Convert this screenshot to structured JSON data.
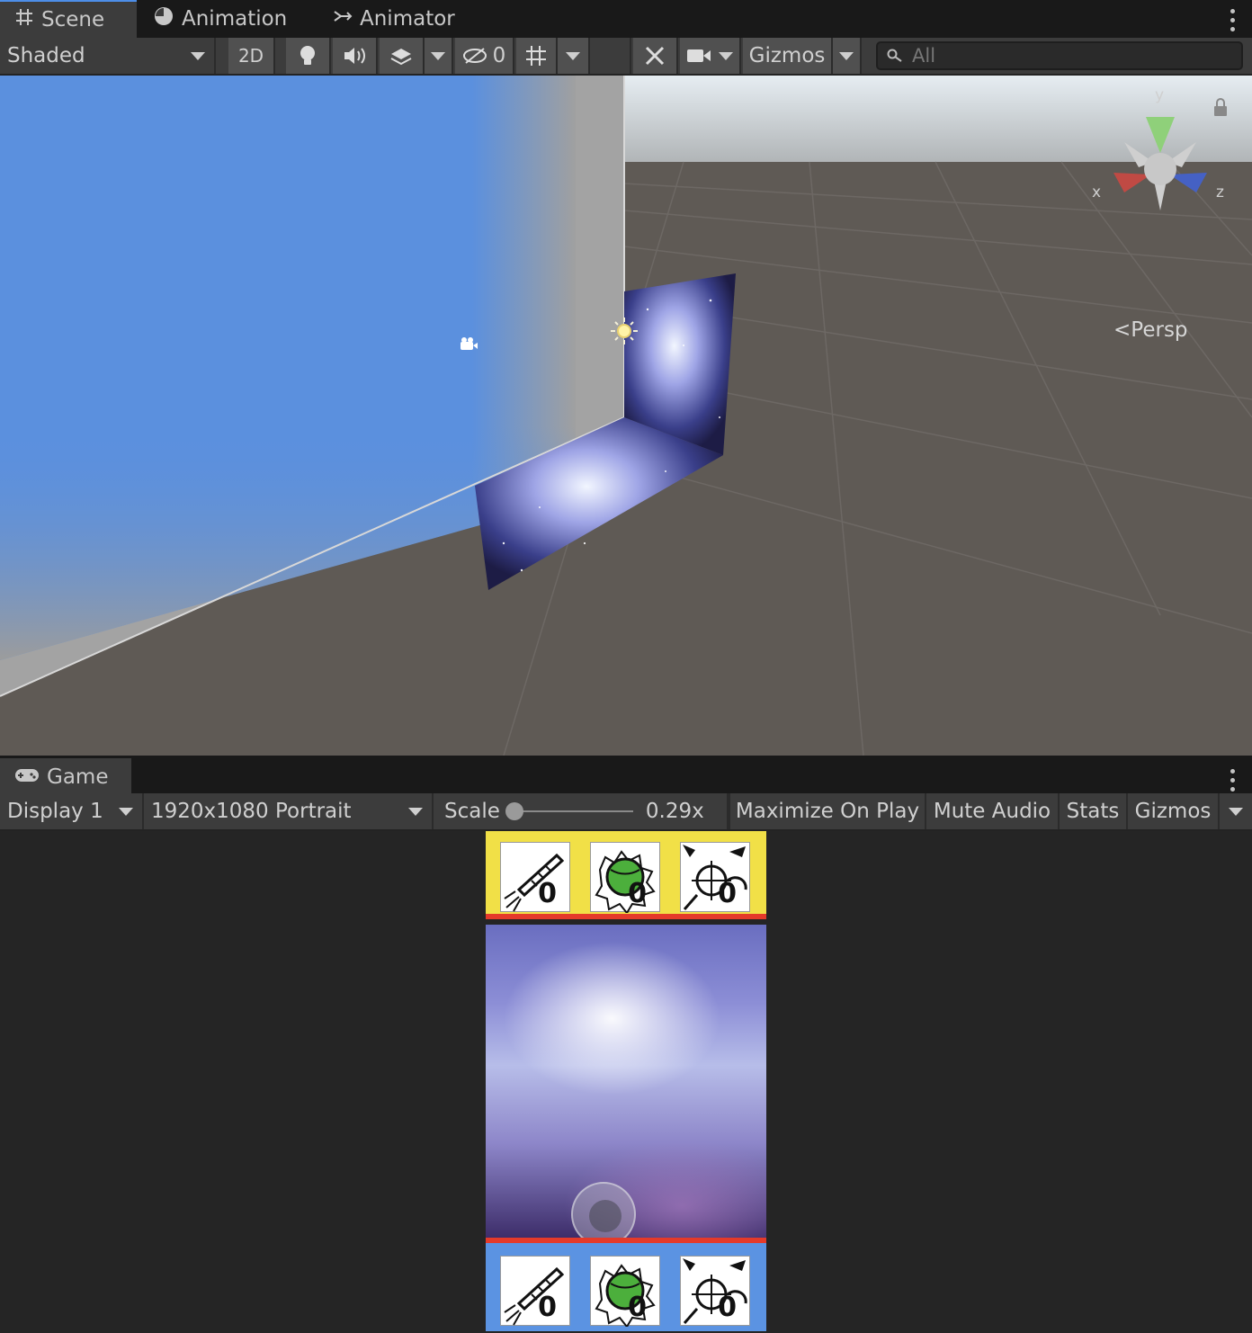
{
  "scene_tabs": [
    {
      "label": "Scene",
      "icon": "grid-hash-icon",
      "active": true
    },
    {
      "label": "Animation",
      "icon": "clock-pie-icon",
      "active": false
    },
    {
      "label": "Animator",
      "icon": "animator-graph-icon",
      "active": false
    }
  ],
  "scene_toolbar": {
    "shading_mode": "Shaded",
    "toggle_2d": "2D",
    "hidden_count": "0",
    "gizmos": "Gizmos",
    "search_placeholder": "All"
  },
  "scene_view": {
    "projection": "Persp",
    "axis_x": "x",
    "axis_y": "y",
    "axis_z": "z"
  },
  "game_tab": {
    "label": "Game",
    "icon": "gamepad-icon"
  },
  "game_toolbar": {
    "display": "Display 1",
    "resolution": "1920x1080 Portrait",
    "scale_label": "Scale",
    "scale_value": "0.29x",
    "scale_slider_fraction": 0.0,
    "maximize_on_play": "Maximize On Play",
    "mute_audio": "Mute Audio",
    "stats": "Stats",
    "gizmos": "Gizmos"
  },
  "game_view": {
    "top_hud": [
      {
        "icon": "rocket-missile-icon",
        "count": "0"
      },
      {
        "icon": "green-bomb-icon",
        "count": "0"
      },
      {
        "icon": "crosshair-turret-icon",
        "count": "0"
      }
    ],
    "bottom_hud": [
      {
        "icon": "rocket-missile-icon",
        "count": "0"
      },
      {
        "icon": "green-bomb-icon",
        "count": "0"
      },
      {
        "icon": "crosshair-turret-icon",
        "count": "0"
      }
    ],
    "colors": {
      "top_hud": "#f1e047",
      "bottom_hud": "#5b93e2",
      "divider": "#e53a2a"
    }
  }
}
